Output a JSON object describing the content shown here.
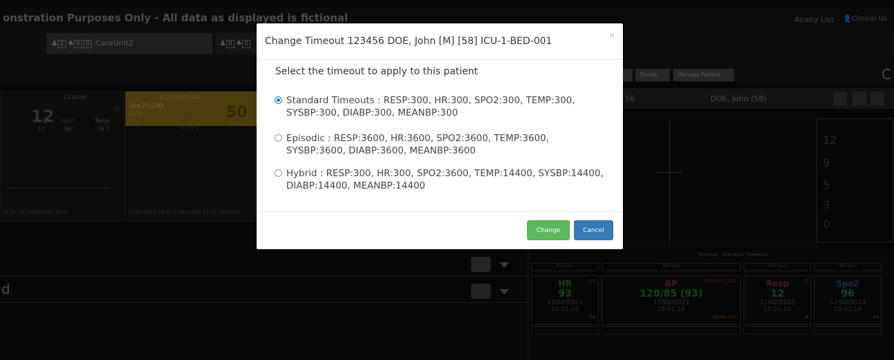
{
  "app": {
    "banner": "onstration Purposes Only - All data as displayed is fictional",
    "acuity_list": "Acuity List",
    "clinical_user": "Clinical Us",
    "care_unit": "CareUnit2",
    "unit_counts_1": [
      "2",
      "0",
      "0"
    ],
    "unit_counts_2": [
      "0",
      "0"
    ],
    "subtabs": [
      "Trends",
      "Manage Patient"
    ],
    "c_letter": "C",
    "card1": {
      "id": "123456",
      "score": "12",
      "labels": [
        "Resp",
        "Spo2",
        "Temp"
      ],
      "values": [
        "12",
        "96",
        "36.3"
      ],
      "dates": "23 17:12  17/02/2023 18:52"
    },
    "card2": {
      "bed": "ICU2-BED-02",
      "name": "Doe",
      "sex_age": "[F] [28]",
      "first": "Jane",
      "score": "50",
      "labels": [
        "HR",
        "BP",
        "Resp"
      ],
      "values": [
        "--",
        "--/-- (--)",
        "--"
      ],
      "dates": "17/02/2023 15:52  17/02/2023 17:12  17/02/20"
    },
    "patient_header": {
      "id_fragment": "56",
      "name": "DOE, John (58)"
    },
    "right_scores": [
      "12",
      "9",
      "5",
      "3",
      "0"
    ],
    "row_d": "d",
    "timeout_label": "Timeout : Standard Timeouts",
    "secs": [
      "300 Secs",
      "300 Secs",
      "300 Secs",
      "300 Secs"
    ],
    "vitals": [
      {
        "name": "HR",
        "value": "93",
        "high": "120",
        "low": "40",
        "date": "17/02/2023",
        "time": "19:51:16"
      },
      {
        "name": "BP",
        "value": "120/85 (93)",
        "high": "190/130 (160)",
        "low": "91/40 (57)",
        "date": "17/02/2023",
        "time": "19:51:16"
      },
      {
        "name": "Resp",
        "value": "12",
        "high": "25",
        "low": "8",
        "date": "17/02/2023",
        "time": "19:51:16"
      },
      {
        "name": "Spo2",
        "value": "96",
        "high": "",
        "low": "94",
        "date": "17/02/2023",
        "time": "19:51:16"
      }
    ]
  },
  "modal": {
    "title": "Change Timeout 123456 DOE, John [M] [58] ICU-1-BED-001",
    "close": "×",
    "prompt": "Select the timeout to apply to this patient",
    "options": [
      {
        "label": "Standard Timeouts : RESP:300, HR:300, SPO2:300, TEMP:300, SYSBP:300, DIABP:300, MEANBP:300",
        "selected": true
      },
      {
        "label": "Episodic : RESP:3600, HR:3600, SPO2:3600, TEMP:3600, SYSBP:3600, DIABP:3600, MEANBP:3600",
        "selected": false
      },
      {
        "label": "Hybrid : RESP:300, HR:300, SPO2:3600, TEMP:14400, SYSBP:14400, DIABP:14400, MEANBP:14400",
        "selected": false
      }
    ],
    "change_label": "Change",
    "cancel_label": "Cancel"
  },
  "colors": {
    "change_button": "#5cb85c",
    "cancel_button": "#337ab7",
    "radio_selected": "#1a73e8",
    "vital_green": "#2e9e3c",
    "vital_red": "#b33a3a",
    "vital_orange": "#c27a1a"
  }
}
